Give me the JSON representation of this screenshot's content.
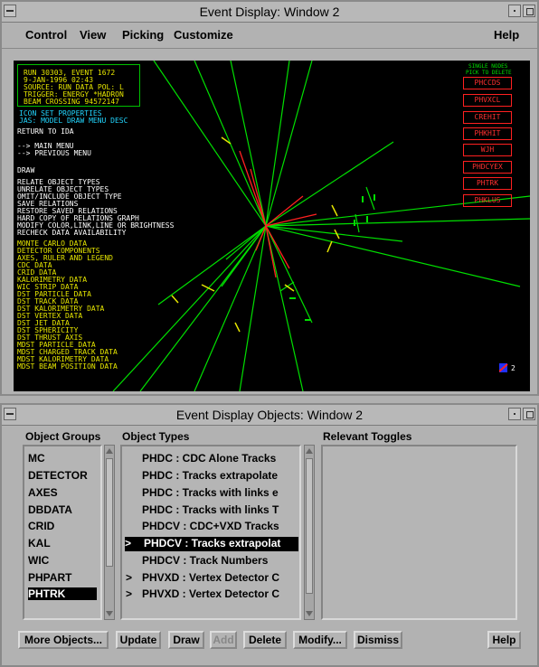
{
  "top_window": {
    "title": "Event Display:  Window 2",
    "menus": [
      "Control",
      "View",
      "Picking",
      "Customize"
    ],
    "help": "Help"
  },
  "display": {
    "info_lines": [
      "RUN  30303,    EVENT    1672",
      "  9-JAN-1996 02:43",
      "SOURCE: RUN DATA    POL: L",
      "TRIGGER: ENERGY *HADRON",
      "BEAM CROSSING         94572147"
    ],
    "cyan_lines": [
      "ICON SET PROPERTIES",
      "JAS: MODEL DRAW MENU DESC"
    ],
    "white_lines": [
      "RETURN TO IDA",
      "",
      "--> MAIN MENU",
      "--> PREVIOUS MENU",
      "",
      "",
      "DRAW",
      "",
      "RELATE OBJECT TYPES",
      "UNRELATE OBJECT TYPES",
      "OMIT/INCLUDE OBJECT TYPE",
      "SAVE RELATIONS",
      "RESTORE SAVED RELATIONS",
      "HARD COPY OF RELATIONS GRAPH",
      "MODIFY COLOR,LINK,LINE OR BRIGHTNESS",
      "RECHECK DATA AVAILABILITY"
    ],
    "yellow_lines": [
      "MONTE CARLO DATA",
      "DETECTOR COMPONENTS",
      "AXES, RULER AND LEGEND",
      "CDC DATA",
      "CRID DATA",
      "KALORIMETRY DATA",
      "WIC STRIP DATA",
      "DST PARTICLE DATA",
      "DST TRACK DATA",
      "DST KALORIMETRY DATA",
      "DST VERTEX DATA",
      "DST JET DATA",
      "DST SPHERICITY",
      "DST THRUST AXIS",
      "MDST PARTICLE DATA",
      "MDST CHARGED TRACK DATA",
      "MDST KALORIMETRY DATA",
      "MDST BEAM POSITION DATA"
    ],
    "pick_header": [
      "SINGLE NODES",
      "PICK TO DELETE"
    ],
    "node_buttons": [
      "PHCCDS",
      "PHVXCL",
      "CREHIT",
      "PHKHIT",
      "WJH",
      "PHDCYEX",
      "PHTRK",
      "PHKLUS"
    ],
    "corner_label": "2",
    "colors": {
      "background": "#000000",
      "tracks": "#00e000",
      "vertex": "#ff2020",
      "hits": "#e6e600",
      "menu_text": "#ffffff"
    }
  },
  "bottom_window": {
    "title": "Event Display Objects: Window 2",
    "groups_label": "Object Groups",
    "groups": [
      "MC",
      "DETECTOR",
      "AXES",
      "DBDATA",
      "CRID",
      "KAL",
      "WIC",
      "PHPART",
      "PHTRK"
    ],
    "selected_group": "PHTRK",
    "types_label": "Object Types",
    "types": [
      {
        "marker": "",
        "text": "PHDC    : CDC Alone Tracks"
      },
      {
        "marker": "",
        "text": "PHDC    : Tracks extrapolate"
      },
      {
        "marker": "",
        "text": "PHDC    : Tracks with links e"
      },
      {
        "marker": "",
        "text": "PHDC    : Tracks with links T"
      },
      {
        "marker": "",
        "text": "PHDCV   : CDC+VXD Tracks"
      },
      {
        "marker": ">",
        "text": "PHDCV   : Tracks extrapolat"
      },
      {
        "marker": "",
        "text": "PHDCV   : Track Numbers"
      },
      {
        "marker": ">",
        "text": "PHVXD   : Vertex Detector C"
      },
      {
        "marker": ">",
        "text": "PHVXD   : Vertex Detector C"
      }
    ],
    "selected_type_index": 5,
    "toggles_label": "Relevant Toggles",
    "buttons": {
      "more": "More Objects...",
      "update": "Update",
      "draw": "Draw",
      "add": "Add",
      "delete": "Delete",
      "modify": "Modify...",
      "dismiss": "Dismiss",
      "help": "Help"
    }
  }
}
